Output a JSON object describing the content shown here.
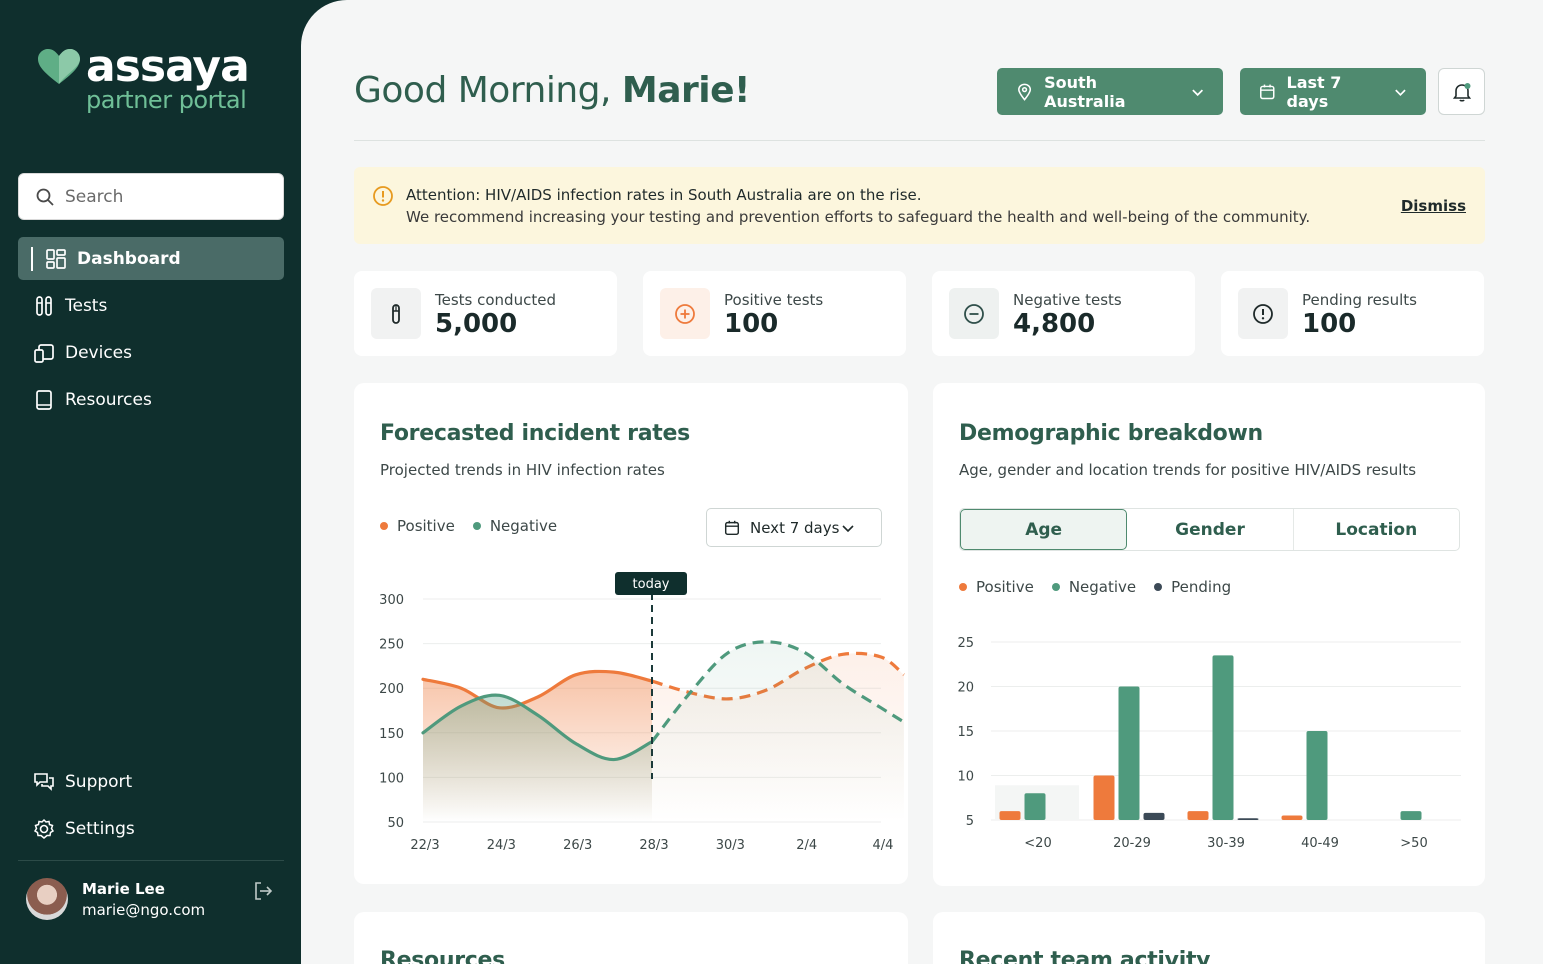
{
  "brand": {
    "name": "assaya",
    "subtitle": "partner portal"
  },
  "search": {
    "placeholder": "Search"
  },
  "nav": {
    "items": [
      {
        "label": "Dashboard",
        "active": true
      },
      {
        "label": "Tests"
      },
      {
        "label": "Devices"
      },
      {
        "label": "Resources"
      }
    ],
    "bottom": [
      {
        "label": "Support"
      },
      {
        "label": "Settings"
      }
    ]
  },
  "user": {
    "name": "Marie Lee",
    "email": "marie@ngo.com"
  },
  "header": {
    "greeting_prefix": "Good Morning, ",
    "greeting_name": "Marie!",
    "region": "South Australia",
    "range": "Last 7 days"
  },
  "alert": {
    "title": "Attention: HIV/AIDS infection rates in South Australia are on the rise.",
    "text": "We recommend increasing your testing and prevention efforts to safeguard the health and well-being of the community.",
    "dismiss": "Dismiss"
  },
  "stats": [
    {
      "label": "Tests conducted",
      "value": "5,000"
    },
    {
      "label": "Positive tests",
      "value": "100"
    },
    {
      "label": "Negative tests",
      "value": "4,800"
    },
    {
      "label": "Pending results",
      "value": "100"
    }
  ],
  "forecast": {
    "title": "Forecasted incident rates",
    "subtitle": "Projected trends in HIV infection rates",
    "legend_positive": "Positive",
    "legend_negative": "Negative",
    "range": "Next 7 days",
    "today_label": "today"
  },
  "demographic": {
    "title": "Demographic breakdown",
    "subtitle": "Age, gender and location trends for positive HIV/AIDS results",
    "tabs": [
      "Age",
      "Gender",
      "Location"
    ],
    "legend_positive": "Positive",
    "legend_negative": "Negative",
    "legend_pending": "Pending"
  },
  "bottom_cards": {
    "left_title": "Resources",
    "right_title": "Recent team activity"
  },
  "colors": {
    "positive": "#ee7a3c",
    "negative": "#4f9a7d",
    "pending": "#3c4a57",
    "brand": "#4f8a6f"
  },
  "chart_data": [
    {
      "type": "line",
      "x": [
        "22/3",
        "24/3",
        "26/3",
        "28/3",
        "30/3",
        "2/4",
        "4/4"
      ],
      "ylim": [
        50,
        300
      ],
      "yticks": [
        50,
        100,
        150,
        200,
        250,
        300
      ],
      "series": [
        {
          "name": "Positive",
          "x": [
            0,
            0.5,
            1,
            1.5,
            2,
            2.5,
            3,
            3.5,
            4,
            4.5,
            5,
            5.5,
            6,
            6.3
          ],
          "values": [
            210,
            200,
            178,
            190,
            215,
            218,
            208,
            195,
            188,
            198,
            222,
            238,
            235,
            215
          ]
        },
        {
          "name": "Negative",
          "x": [
            0,
            0.5,
            1,
            1.5,
            2,
            2.5,
            3,
            3.5,
            4,
            4.5,
            5,
            5.5,
            6,
            6.3
          ],
          "values": [
            150,
            180,
            192,
            170,
            138,
            120,
            140,
            195,
            240,
            252,
            240,
            205,
            178,
            162
          ]
        }
      ],
      "today_x": 3
    },
    {
      "type": "bar",
      "categories": [
        "<20",
        "20-29",
        "30-39",
        "40-49",
        ">50"
      ],
      "ylim": [
        5,
        25
      ],
      "yticks": [
        5,
        10,
        15,
        20,
        25
      ],
      "series": [
        {
          "name": "Positive",
          "values": [
            6,
            10,
            6,
            5.5,
            0
          ]
        },
        {
          "name": "Negative",
          "values": [
            8,
            20,
            23.5,
            15,
            6
          ]
        },
        {
          "name": "Pending",
          "values": [
            0,
            5.8,
            5.2,
            0,
            0
          ]
        }
      ]
    }
  ]
}
